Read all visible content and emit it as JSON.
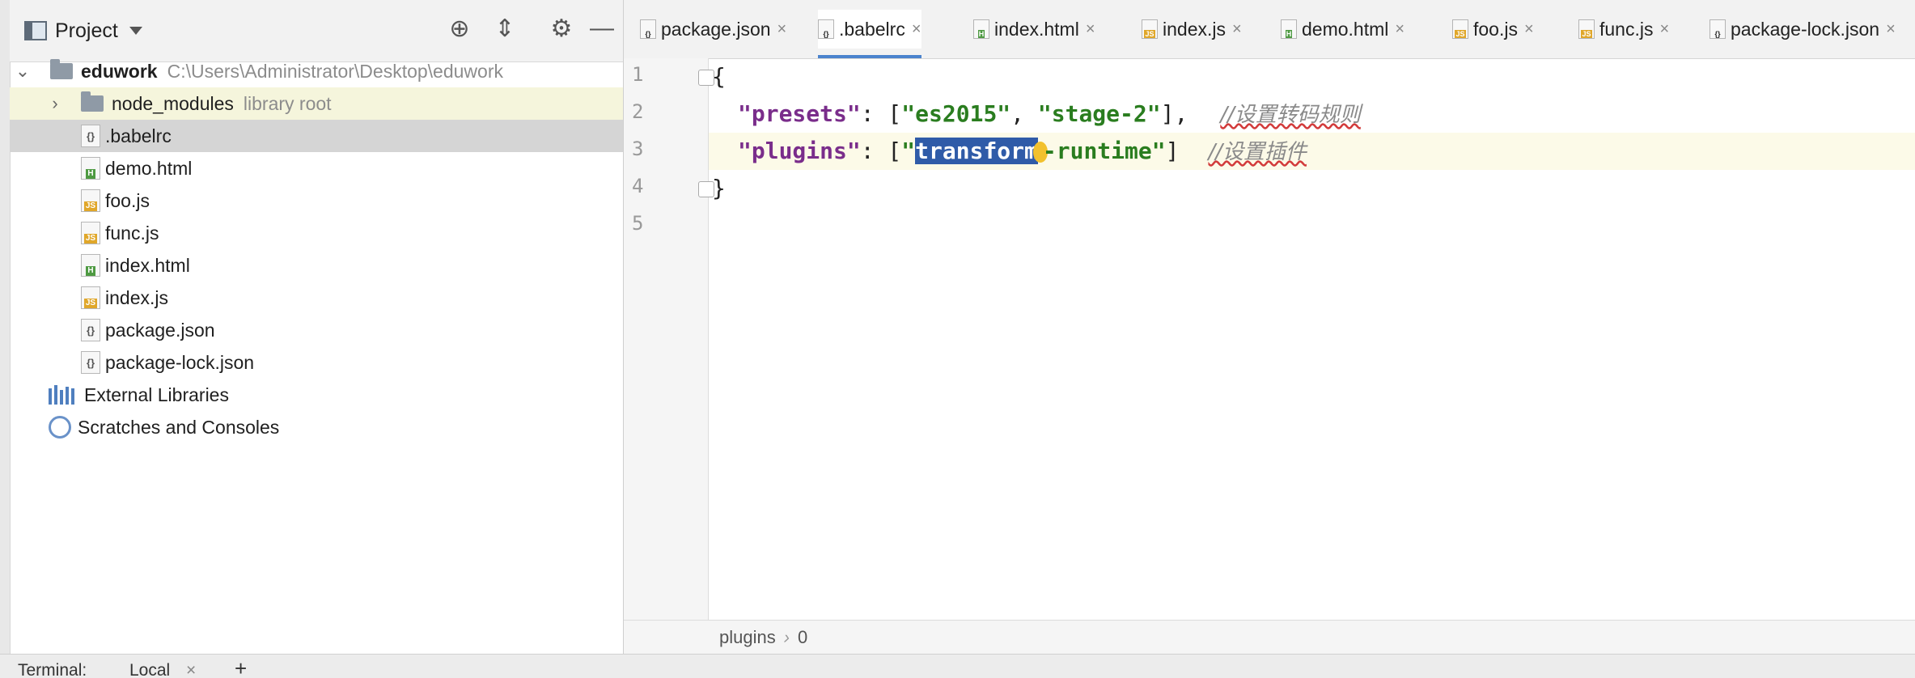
{
  "project_panel": {
    "title": "Project",
    "header_icons": [
      "crosshair-icon",
      "collapse-icon",
      "gear-icon",
      "minimize-icon"
    ],
    "root": {
      "name": "eduwork",
      "path": "C:\\Users\\Administrator\\Desktop\\eduwork"
    },
    "node_modules": {
      "name": "node_modules",
      "note": "library root"
    },
    "files": [
      ".babelrc",
      "demo.html",
      "foo.js",
      "func.js",
      "index.html",
      "index.js",
      "package.json",
      "package-lock.json"
    ],
    "external_libraries": "External Libraries",
    "scratches": "Scratches and Consoles"
  },
  "tabs": [
    {
      "label": "package.json",
      "icon": "json",
      "active": false
    },
    {
      "label": ".babelrc",
      "icon": "json",
      "active": true
    },
    {
      "label": "index.html",
      "icon": "html",
      "active": false
    },
    {
      "label": "index.js",
      "icon": "js",
      "active": false
    },
    {
      "label": "demo.html",
      "icon": "html",
      "active": false
    },
    {
      "label": "foo.js",
      "icon": "js",
      "active": false
    },
    {
      "label": "func.js",
      "icon": "js",
      "active": false
    },
    {
      "label": "package-lock.json",
      "icon": "json",
      "active": false
    }
  ],
  "editor": {
    "line_numbers": [
      "1",
      "2",
      "3",
      "4",
      "5"
    ],
    "line1": "{",
    "line2": {
      "key": "\"presets\"",
      "colon": ": [",
      "v1": "\"es2015\"",
      "comma": ", ",
      "v2": "\"stage-2\"",
      "end": "],",
      "comment": "//设置转码规则"
    },
    "line3": {
      "key": "\"plugins\"",
      "colon": ": [",
      "quote": "\"",
      "selected": "transform",
      "rest": "-runtime\"",
      "end": "]",
      "comment": "//设置插件"
    },
    "line4": "}"
  },
  "breadcrumb": {
    "part1": "plugins",
    "separator": "›",
    "part2": "0"
  },
  "terminal": {
    "label": "Terminal:",
    "tab": "Local",
    "close": "×",
    "add": "+"
  }
}
